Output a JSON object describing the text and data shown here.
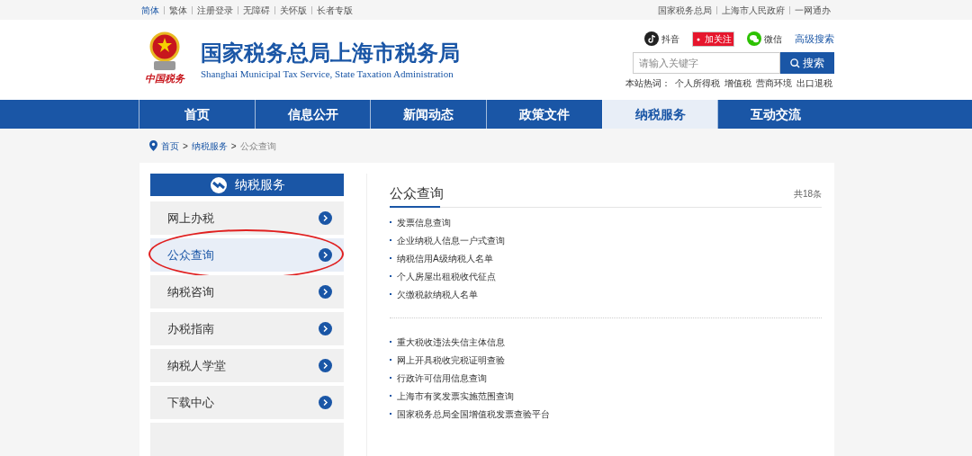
{
  "top_bar": {
    "left_links": [
      {
        "label": "简体",
        "selected": true
      },
      {
        "label": "繁体",
        "selected": false
      },
      {
        "label": "注册登录",
        "selected": false
      },
      {
        "label": "无障碍",
        "selected": false
      },
      {
        "label": "关怀版",
        "selected": false
      },
      {
        "label": "长者专版",
        "selected": false
      }
    ],
    "right_links": [
      "国家税务总局",
      "上海市人民政府",
      "一网通办"
    ]
  },
  "header": {
    "logo_caption": "中国税务",
    "title": "国家税务总局上海市税务局",
    "subtitle": "Shanghai Municipal Tax Service, State Taxation Administration",
    "social": [
      {
        "kind": "douyin",
        "label": "抖音"
      },
      {
        "kind": "weibo",
        "label": "加关注"
      },
      {
        "kind": "wechat",
        "label": "微信"
      }
    ],
    "advanced_search": "高级搜索",
    "search": {
      "placeholder": "请输入关键字",
      "button": "搜索"
    },
    "hot_words_label": "本站热词：",
    "hot_words": [
      "个人所得税",
      "增值税",
      "营商环境",
      "出口退税"
    ]
  },
  "nav": [
    {
      "label": "首页",
      "selected": false
    },
    {
      "label": "信息公开",
      "selected": false
    },
    {
      "label": "新闻动态",
      "selected": false
    },
    {
      "label": "政策文件",
      "selected": false
    },
    {
      "label": "纳税服务",
      "selected": true
    },
    {
      "label": "互动交流",
      "selected": false
    }
  ],
  "breadcrumb": [
    {
      "kind": "link",
      "label": "首页"
    },
    {
      "kind": "separator",
      "label": ">"
    },
    {
      "kind": "link",
      "label": "纳税服务"
    },
    {
      "kind": "separator",
      "label": ">"
    },
    {
      "kind": "current",
      "label": "公众查询"
    }
  ],
  "sidebar": {
    "title": "纳税服务",
    "items": [
      {
        "label": "网上办税",
        "selected": false,
        "circled": false
      },
      {
        "label": "公众查询",
        "selected": true,
        "circled": true
      },
      {
        "label": "纳税咨询",
        "selected": false,
        "circled": false
      },
      {
        "label": "办税指南",
        "selected": false,
        "circled": false
      },
      {
        "label": "纳税人学堂",
        "selected": false,
        "circled": false
      },
      {
        "label": "下载中心",
        "selected": false,
        "circled": false
      }
    ]
  },
  "content": {
    "title": "公众查询",
    "count": "共18条",
    "groups": [
      [
        "发票信息查询",
        "企业纳税人信息一户式查询",
        "纳税信用A级纳税人名单",
        "个人房屋出租税收代征点",
        "欠缴税款纳税人名单"
      ],
      [
        "重大税收违法失信主体信息",
        "网上开具税收完税证明查验",
        "行政许可信用信息查询",
        "上海市有奖发票实施范围查询",
        "国家税务总局全国增值税发票查验平台"
      ]
    ]
  }
}
